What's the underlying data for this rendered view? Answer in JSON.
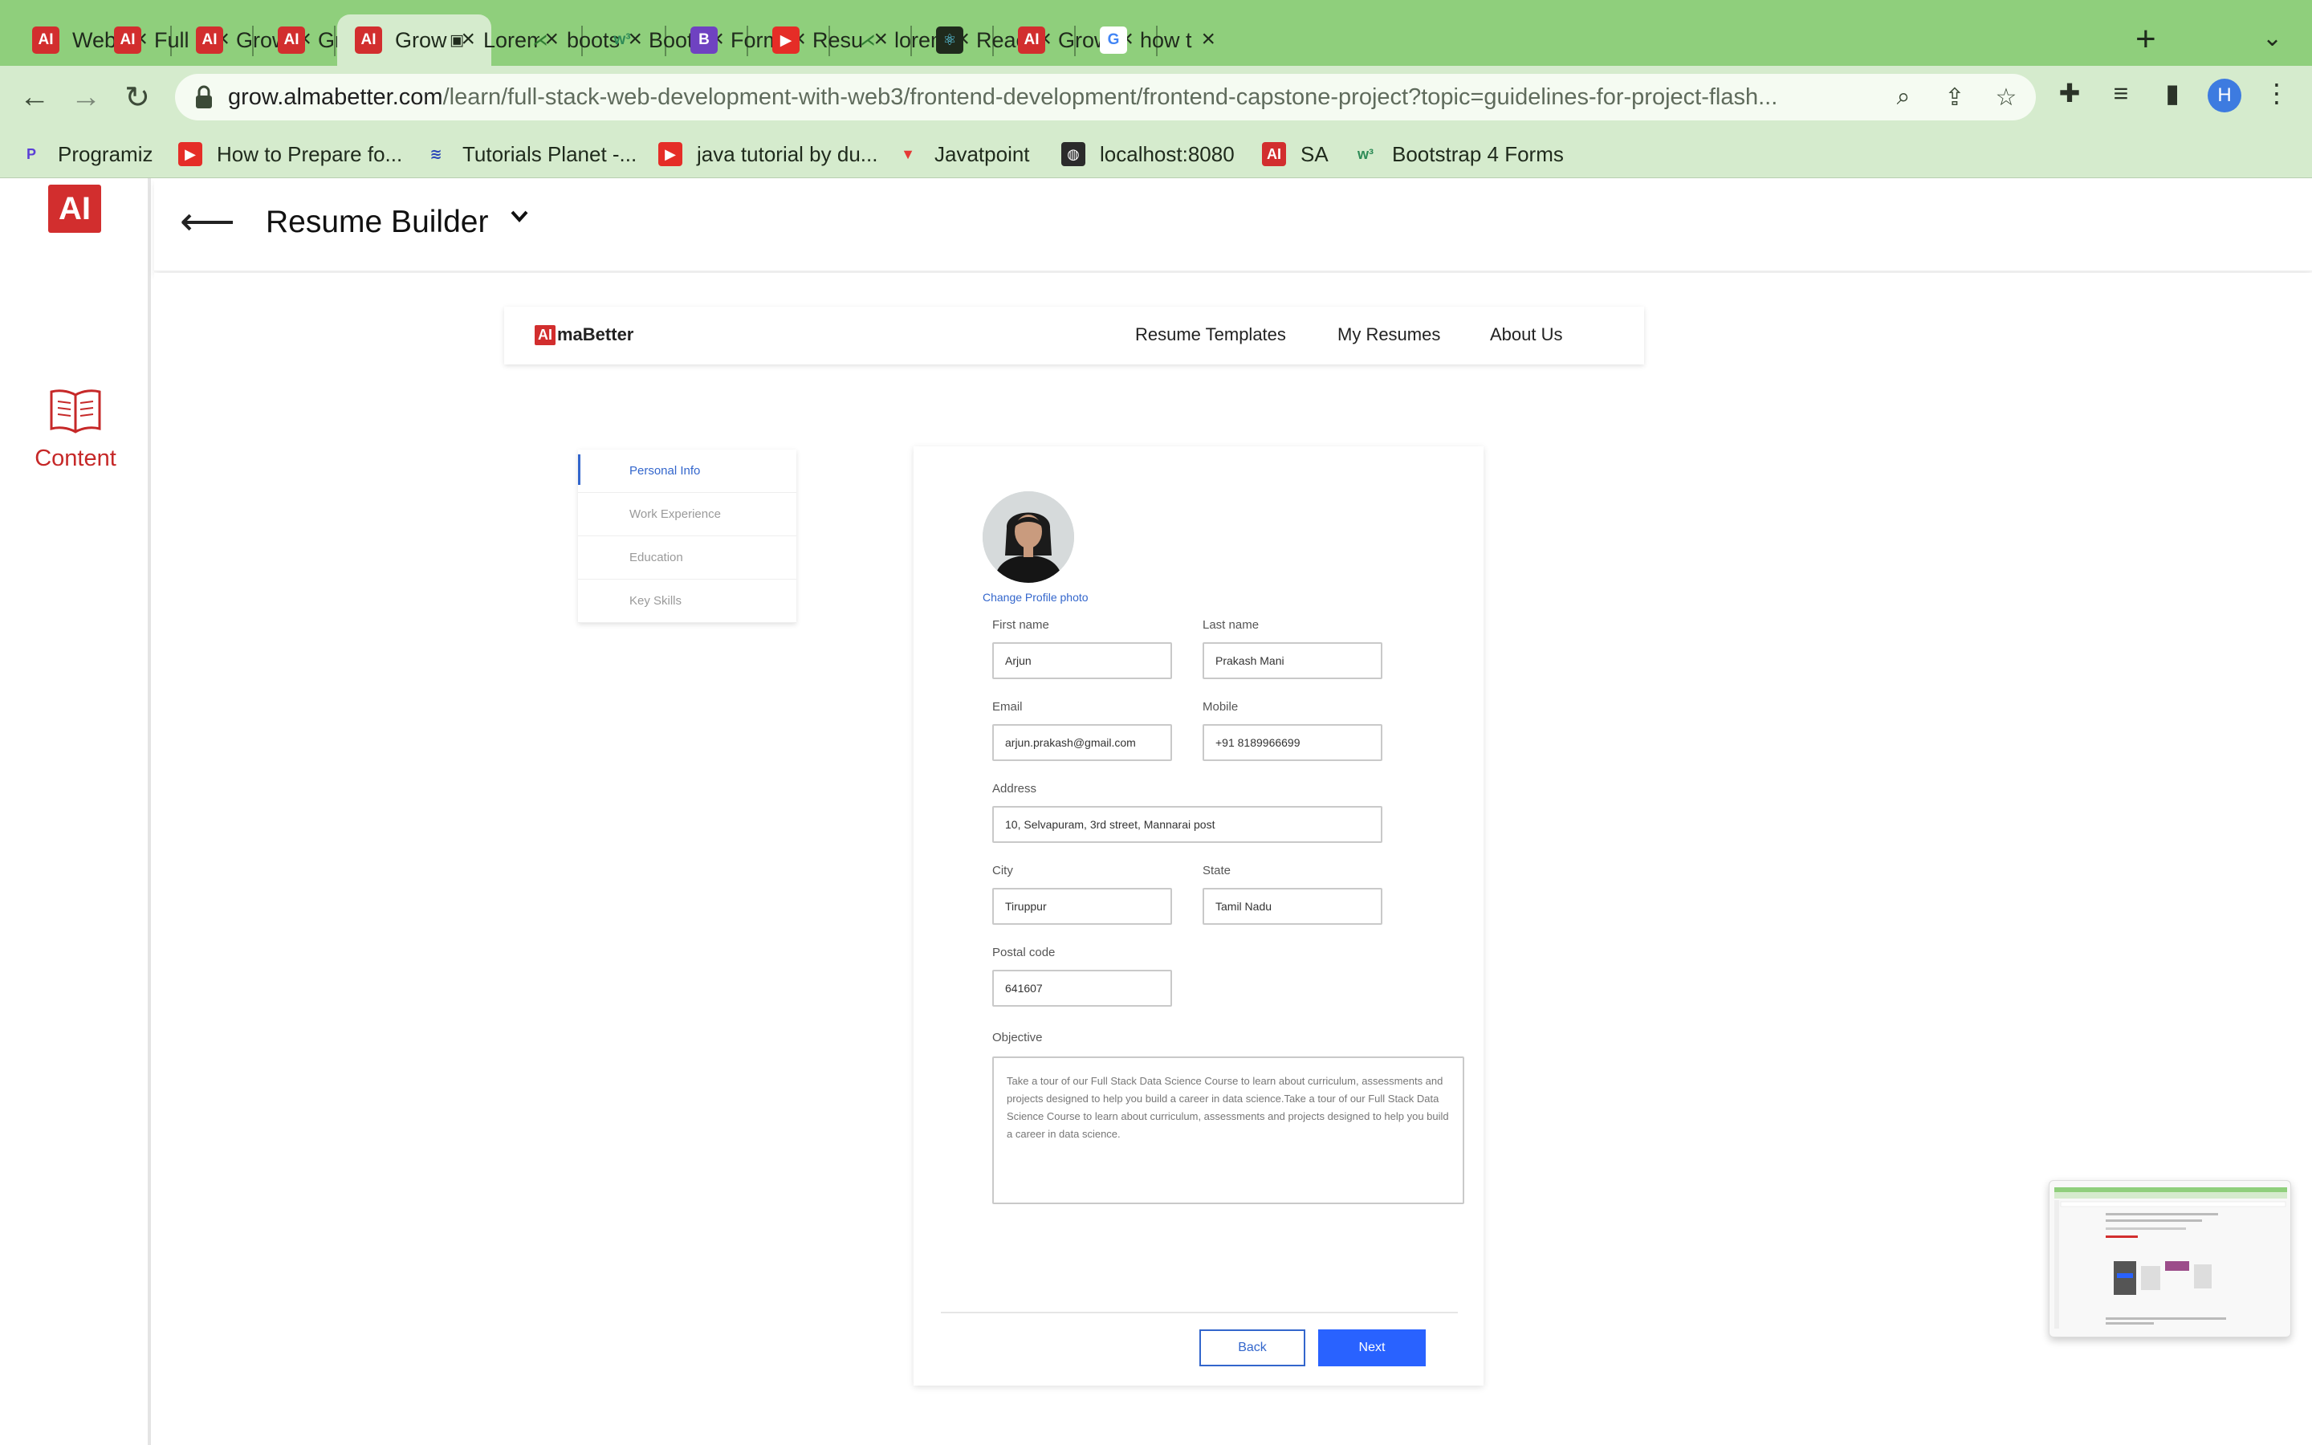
{
  "browser": {
    "tabs": [
      {
        "title": "Web",
        "icon": "almabetter-icon"
      },
      {
        "title": "Full S",
        "icon": "almabetter-icon"
      },
      {
        "title": "Grow",
        "icon": "almabetter-icon"
      },
      {
        "title": "Grow",
        "icon": "almabetter-icon"
      },
      {
        "title": "Grow",
        "icon": "almabetter-icon",
        "active": true
      },
      {
        "title": "Lorem",
        "icon": "image-icon"
      },
      {
        "title": "boots",
        "icon": "bootstrap-icon"
      },
      {
        "title": "Boots",
        "icon": "w3schools-icon"
      },
      {
        "title": "Form",
        "icon": "bootstrap-b-icon"
      },
      {
        "title": "Resu",
        "icon": "youtube-icon"
      },
      {
        "title": "lorem",
        "icon": "bootstrap-icon"
      },
      {
        "title": "Reac",
        "icon": "react-icon"
      },
      {
        "title": "Grow",
        "icon": "almabetter-icon"
      },
      {
        "title": "how t",
        "icon": "google-icon"
      }
    ],
    "url_host": "grow.almabetter.com",
    "url_path": "/learn/full-stack-web-development-with-web3/frontend-development/frontend-capstone-project?topic=guidelines-for-project-flash...",
    "profile_initial": "H",
    "bookmarks": [
      {
        "label": "Programiz",
        "icon": "programiz-icon"
      },
      {
        "label": "How to Prepare fo...",
        "icon": "youtube-icon"
      },
      {
        "label": "Tutorials Planet -...",
        "icon": "tutorials-planet-icon"
      },
      {
        "label": "java tutorial by du...",
        "icon": "youtube-icon"
      },
      {
        "label": "Javatpoint",
        "icon": "javatpoint-icon"
      },
      {
        "label": "localhost:8080",
        "icon": "globe-icon"
      },
      {
        "label": "SA",
        "icon": "almabetter-icon"
      },
      {
        "label": "Bootstrap 4 Forms",
        "icon": "w3schools-icon"
      }
    ],
    "colors": {
      "tabbar": "#8fcf7c",
      "toolbar": "#d5ebcd"
    }
  },
  "sidebar": {
    "logo_text": "AI",
    "content_label": "Content"
  },
  "header": {
    "title": "Resume Builder"
  },
  "app": {
    "logo_mark": "AI",
    "logo_text": "maBetter",
    "nav": [
      "Resume Templates",
      "My Resumes",
      "About Us"
    ],
    "steps": [
      "Personal Info",
      "Work Experience",
      "Education",
      "Key Skills"
    ],
    "active_step": "Personal Info",
    "change_photo": "Change Profile photo",
    "fields": {
      "first_name": {
        "label": "First name",
        "value": "Arjun"
      },
      "last_name": {
        "label": "Last name",
        "value": "Prakash Mani"
      },
      "email": {
        "label": "Email",
        "value": "arjun.prakash@gmail.com"
      },
      "mobile": {
        "label": "Mobile",
        "value": "+91 8189966699"
      },
      "address": {
        "label": "Address",
        "value": "10, Selvapuram, 3rd street, Mannarai post"
      },
      "city": {
        "label": "City",
        "value": "Tiruppur"
      },
      "state": {
        "label": "State",
        "value": "Tamil Nadu"
      },
      "postal_code": {
        "label": "Postal code",
        "value": "641607"
      },
      "objective": {
        "label": "Objective",
        "value": "Take a tour of our Full Stack Data Science Course to learn about curriculum, assessments and projects designed to help you build a career in data science.Take a tour of our Full Stack Data Science Course to learn about curriculum, assessments and projects designed to help you build a career in data science."
      }
    },
    "back_label": "Back",
    "next_label": "Next",
    "colors": {
      "accent": "#2962ff",
      "brand": "#d22e2e"
    }
  }
}
